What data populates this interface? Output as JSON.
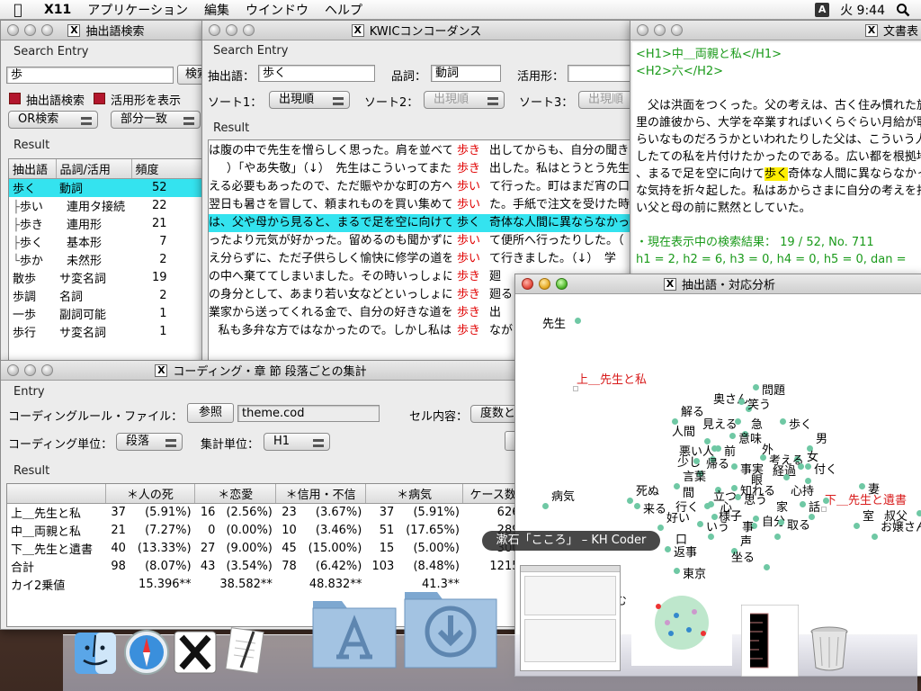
{
  "menubar": {
    "app": "X11",
    "items": [
      "アプリケーション",
      "編集",
      "ウインドウ",
      "ヘルプ"
    ],
    "ime": "A",
    "clock": "火 9:44"
  },
  "win_extract": {
    "title": "抽出語検索",
    "search_section": "Search Entry",
    "query": "歩",
    "search_button": "検索",
    "opt1": "抽出語検索",
    "opt2": "活用形を表示",
    "mode_select": "OR検索",
    "match_select": "部分一致",
    "result_section": "Result",
    "columns": [
      "抽出語",
      "品詞/活用",
      "頻度"
    ],
    "rows": [
      {
        "word": "歩く",
        "pos": "動詞",
        "freq": "52",
        "indent": 0,
        "sel": true
      },
      {
        "word": "歩い",
        "pos": "連用タ接続",
        "freq": "22",
        "indent": 1,
        "sel": false
      },
      {
        "word": "歩き",
        "pos": "連用形",
        "freq": "21",
        "indent": 1,
        "sel": false
      },
      {
        "word": "歩く",
        "pos": "基本形",
        "freq": "7",
        "indent": 1,
        "sel": false
      },
      {
        "word": "歩か",
        "pos": "未然形",
        "freq": "2",
        "indent": 1,
        "sel": false
      },
      {
        "word": "散歩",
        "pos": "サ変名詞",
        "freq": "19",
        "indent": 0,
        "sel": false
      },
      {
        "word": "歩調",
        "pos": "名詞",
        "freq": "2",
        "indent": 0,
        "sel": false
      },
      {
        "word": "一歩",
        "pos": "副詞可能",
        "freq": "1",
        "indent": 0,
        "sel": false
      },
      {
        "word": "歩行",
        "pos": "サ変名詞",
        "freq": "1",
        "indent": 0,
        "sel": false
      }
    ]
  },
  "win_kwic": {
    "title": "KWICコンコーダンス",
    "search_section": "Search Entry",
    "word_label": "抽出語：",
    "word_value": "歩く",
    "pos_label": "品詞：",
    "pos_value": "動詞",
    "conj_label": "活用形：",
    "conj_value": "",
    "sort1_label": "ソート1：",
    "sort1_value": "出現順",
    "sort2_label": "ソート2：",
    "sort2_value": "出現順",
    "sort3_label": "ソート3：",
    "sort3_value": "出現順",
    "result_section": "Result",
    "lines": [
      {
        "l": "は腹の中で先生を憎らしく思った。肩を並べて",
        "k": "歩き",
        "r": "出してからも、自分の聞き",
        "sel": false
      },
      {
        "l": "）「やあ失敬」（↓）　先生はこういってまた",
        "k": "歩き",
        "r": "出した。私はとうとう先生",
        "sel": false
      },
      {
        "l": "える必要もあったので、ただ賑やかな町の方へ",
        "k": "歩い",
        "r": "て行った。町はまだ宵の口",
        "sel": false
      },
      {
        "l": "翌日も暑さを冒して、頼まれものを買い集めて",
        "k": "歩い",
        "r": "た。手紙で注文を受けた時",
        "sel": false
      },
      {
        "l": "は、父や母から見ると、まるで足を空に向けて",
        "k": "歩く",
        "r": "奇体な人間に異ならなかっ",
        "sel": true
      },
      {
        "l": "ったより元気が好かった。留めるのも聞かずに",
        "k": "歩い",
        "r": "て便所へ行ったりした。（",
        "sel": false
      },
      {
        "l": "え分らずに、ただ子供らしく愉快に修学の道を",
        "k": "歩い",
        "r": "て行きました。（↓）　学",
        "sel": false
      },
      {
        "l": "の中へ棄ててしまいました。その時いっしょに",
        "k": "歩き",
        "r": "廻",
        "sel": false
      },
      {
        "l": "の身分として、あまり若い女などといっしょに",
        "k": "歩き",
        "r": "廻る",
        "sel": false
      },
      {
        "l": "業家から送ってくれる金で、自分の好きな道を",
        "k": "歩き",
        "r": "出",
        "sel": false
      },
      {
        "l": "私も多弁な方ではなかったので。しかし私は",
        "k": "歩き",
        "r": "なが",
        "sel": false
      }
    ]
  },
  "win_doc": {
    "title": "文書表",
    "h1": "<H1>中＿両親と私</H1>",
    "h2": "<H2>六</H2>",
    "para": [
      "　父は洪面をつくった。父の考えは、古く住み慣れた旅",
      "里の誰彼から、大学を卒業すればいくらぐらい月給が取",
      "らいなものだろうかといわれたりした父は、こういう人",
      "したての私を片付けたかったのである。広い都を根拠地",
      "、まるで足を空に向けて",
      "な気持を折々起した。私はあからさまに自分の考えを打",
      "い父と母の前に黙然としていた。"
    ],
    "hl_word": "歩く",
    "hl_rest": "奇体な人間に異ならなかっ",
    "stats": "・現在表示中の検索結果： 19 / 52,  No. 711",
    "heads": " h1 = 2,  h2 = 6,  h3 = 0,  h4 = 0,  h5 = 0,  dan ="
  },
  "win_coding": {
    "title": "コーディング・章 節 段落ごとの集計",
    "entry_section": "Entry",
    "rule_label": "コーディングルール・ファイル：",
    "browse_button": "参照",
    "rule_file": "theme.cod",
    "cell_label": "セル内容：",
    "cell_value": "度数とパ",
    "unit_label": "コーディング単位：",
    "unit_value": "段落",
    "agg_label": "集計単位：",
    "agg_value": "H1",
    "result_section": "Result",
    "columns": [
      "",
      "＊人の死",
      "＊恋愛",
      "＊信用・不信",
      "＊病気",
      "ケース数"
    ],
    "rows": [
      [
        "上＿先生と私",
        "37",
        "(5.91%)",
        "16",
        "(2.56%)",
        "23",
        "(3.67%)",
        "37",
        "(5.91%)",
        "626"
      ],
      [
        "中＿両親と私",
        "21",
        "(7.27%)",
        "0",
        "(0.00%)",
        "10",
        "(3.46%)",
        "51",
        "(17.65%)",
        "289"
      ],
      [
        "下＿先生と遺書",
        "40",
        "(13.33%)",
        "27",
        "(9.00%)",
        "45",
        "(15.00%)",
        "15",
        "(5.00%)",
        "300"
      ],
      [
        "合計",
        "98",
        "(8.07%)",
        "43",
        "(3.54%)",
        "78",
        "(6.42%)",
        "103",
        "(8.48%)",
        "1215"
      ]
    ],
    "chi_label": "カイ2乗値",
    "chi": [
      "15.396**",
      "38.582**",
      "48.832**",
      "41.3**"
    ]
  },
  "win_corr": {
    "title": "抽出語・対応分析",
    "words": [
      {
        "t": "先生",
        "red": false
      },
      {
        "t": "上＿先生と私",
        "red": true
      },
      {
        "t": "問題",
        "red": false
      },
      {
        "t": "奥さん",
        "red": false
      },
      {
        "t": "笑う",
        "red": false
      },
      {
        "t": "解る",
        "red": false
      },
      {
        "t": "見える",
        "red": false
      },
      {
        "t": "急",
        "red": false
      },
      {
        "t": "歩く",
        "red": false
      },
      {
        "t": "人間",
        "red": false
      },
      {
        "t": "意味",
        "red": false
      },
      {
        "t": "男",
        "red": false
      },
      {
        "t": "悪い",
        "red": false
      },
      {
        "t": "人",
        "red": false
      },
      {
        "t": "前",
        "red": false
      },
      {
        "t": "外",
        "red": false
      },
      {
        "t": "考える",
        "red": false
      },
      {
        "t": "女",
        "red": false
      },
      {
        "t": "少し",
        "red": false
      },
      {
        "t": "帰る",
        "red": false
      },
      {
        "t": "事実",
        "red": false
      },
      {
        "t": "経過",
        "red": false
      },
      {
        "t": "付く",
        "red": false
      },
      {
        "t": "言葉",
        "red": false
      },
      {
        "t": "眼",
        "red": false
      },
      {
        "t": "死ぬ",
        "red": false
      },
      {
        "t": "知れる",
        "red": false
      },
      {
        "t": "心持",
        "red": false
      },
      {
        "t": "妻",
        "red": false
      },
      {
        "t": "病気",
        "red": false
      },
      {
        "t": "間",
        "red": false
      },
      {
        "t": "立つ",
        "red": false
      },
      {
        "t": "思う",
        "red": false
      },
      {
        "t": "家",
        "red": false
      },
      {
        "t": "話",
        "red": false
      },
      {
        "t": "下＿先生と遺書",
        "red": true
      },
      {
        "t": "行く",
        "red": false
      },
      {
        "t": "心",
        "red": false
      },
      {
        "t": "来る",
        "red": false
      },
      {
        "t": "様子",
        "red": false
      },
      {
        "t": "自分",
        "red": false
      },
      {
        "t": "室",
        "red": false
      },
      {
        "t": "叔父",
        "red": false
      },
      {
        "t": "好い",
        "red": false
      },
      {
        "t": "いう",
        "red": false
      },
      {
        "t": "事",
        "red": false
      },
      {
        "t": "取る",
        "red": false
      },
      {
        "t": "お嬢さん",
        "red": false
      },
      {
        "t": "口",
        "red": false
      },
      {
        "t": "声",
        "red": false
      },
      {
        "t": "返事",
        "red": false
      },
      {
        "t": "坐る",
        "red": false
      },
      {
        "t": "東京",
        "red": false
      },
      {
        "t": "読む",
        "red": false
      },
      {
        "t": "紙",
        "red": false
      }
    ]
  },
  "dock": {
    "tooltip": "漱石「こころ」 – KH Coder",
    "icons": [
      "finder-icon",
      "safari-icon",
      "x11-icon",
      "textedit-icon",
      "applications-folder-icon",
      "downloads-folder-icon",
      "kh-coder-window-thumbnail",
      "plot-window-thumbnail",
      "tree-window-thumbnail",
      "trash-icon"
    ]
  }
}
